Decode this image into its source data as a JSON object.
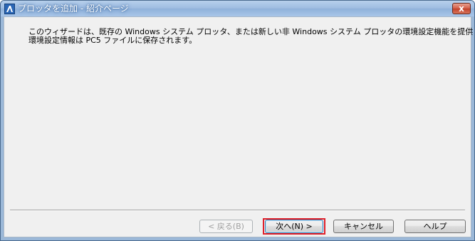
{
  "window": {
    "title": "プロッタを追加 - 紹介ページ",
    "close_label": "x"
  },
  "content": {
    "line1": "このウィザードは、既存の Windows システム プロッタ、または新しい非 Windows システム プロッタの環境設定機能を提供します。",
    "line2": "環境設定情報は PC5 ファイルに保存されます。"
  },
  "buttons": {
    "back": "< 戻る(B)",
    "next": "次へ(N) >",
    "cancel": "キャンセル",
    "help": "ヘルプ"
  },
  "icons": {
    "app": "autocad-plotter-icon",
    "close": "close-icon"
  },
  "colors": {
    "highlight": "#e0202a"
  }
}
